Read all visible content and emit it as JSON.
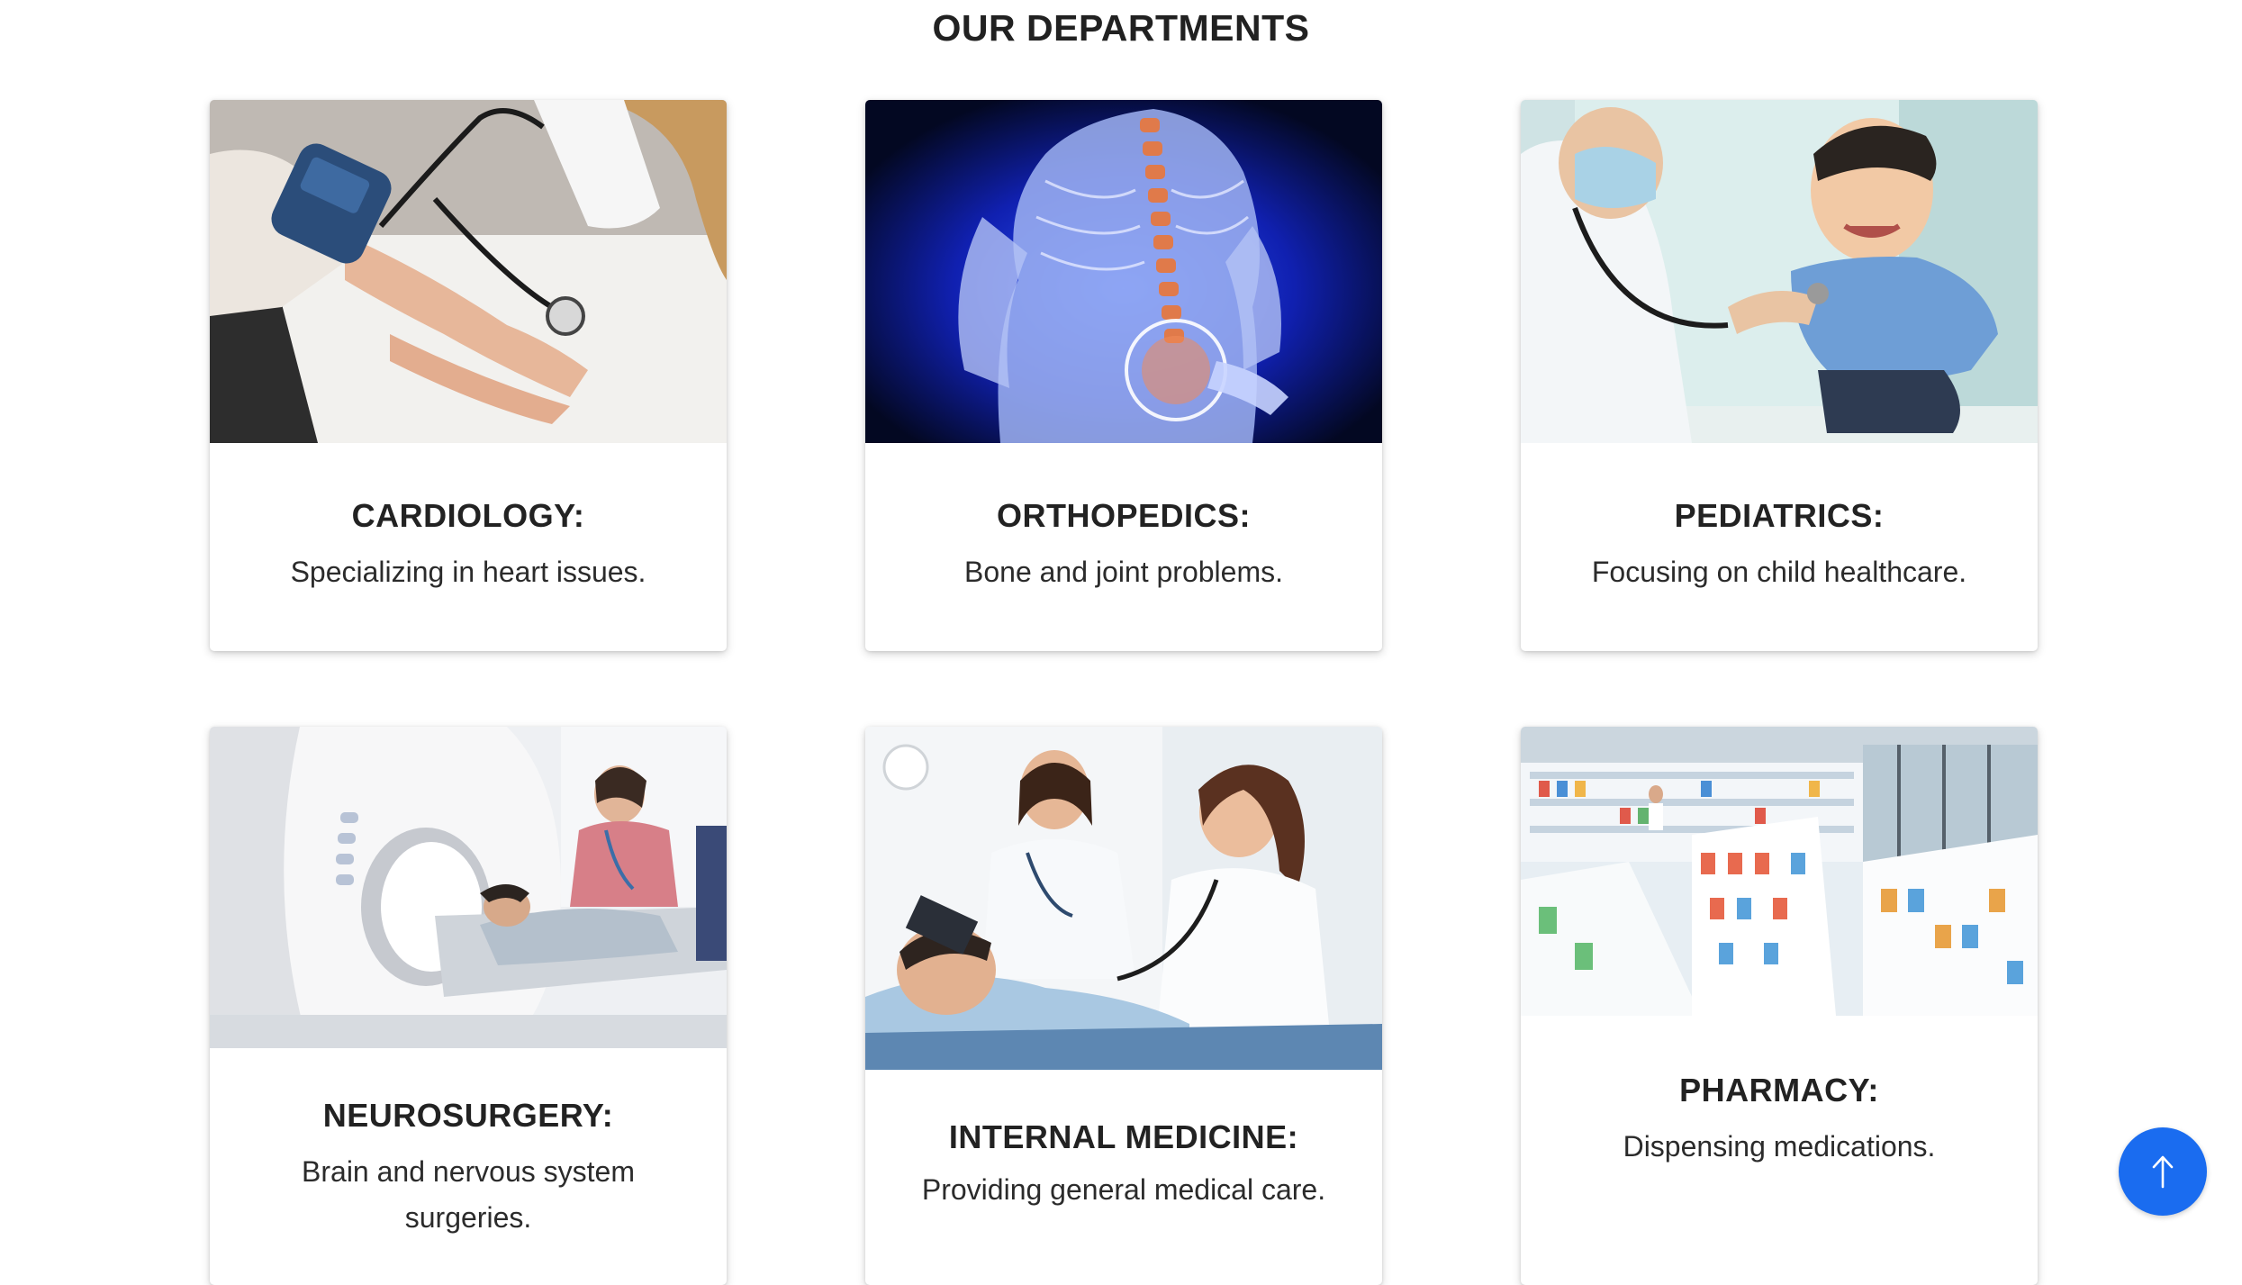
{
  "page": {
    "title": "OUR DEPARTMENTS"
  },
  "departments": [
    {
      "title": "CARDIOLOGY:",
      "description": "Specializing in heart issues.",
      "image": "blood-pressure-measurement-photo"
    },
    {
      "title": "ORTHOPEDICS:",
      "description": "Bone and joint problems.",
      "image": "spine-xray-illustration"
    },
    {
      "title": "PEDIATRICS:",
      "description": "Focusing on child healthcare.",
      "image": "doctor-examining-child-photo"
    },
    {
      "title": "NEUROSURGERY:",
      "description": "Brain and nervous system surgeries.",
      "image": "ct-scanner-patient-photo"
    },
    {
      "title": "INTERNAL MEDICINE:",
      "description": "Providing general medical care.",
      "image": "doctors-with-patient-photo"
    },
    {
      "title": "PHARMACY:",
      "description": "Dispensing medications.",
      "image": "pharmacy-shelves-photo"
    }
  ],
  "scroll_top": {
    "icon": "arrow-up-icon"
  },
  "colors": {
    "accent": "#1a6cf0",
    "heading": "#212121",
    "card_background": "#ffffff"
  }
}
